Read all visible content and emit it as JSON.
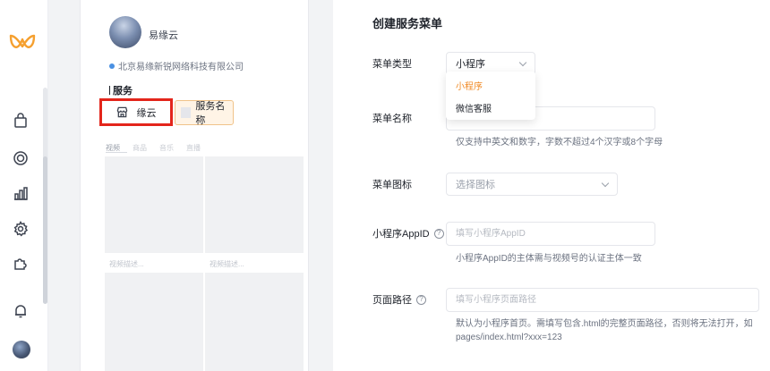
{
  "nav": {
    "items": [
      {
        "icon": "bag-icon"
      },
      {
        "icon": "target-icon"
      },
      {
        "icon": "bar-chart-icon"
      },
      {
        "icon": "gear-icon"
      },
      {
        "icon": "puzzle-icon"
      },
      {
        "icon": "bell-icon"
      }
    ]
  },
  "preview": {
    "account_name": "易缘云",
    "company": "北京易缘新锐网络科技有限公司",
    "services_title": "服务",
    "menu_items": [
      {
        "label": "缘云",
        "icon": "store-icon"
      },
      {
        "label": "服务名称"
      }
    ],
    "tabs": [
      "视频",
      "商品",
      "音乐",
      "直播"
    ],
    "card_captions": [
      "视频描述...",
      "视频描述..."
    ]
  },
  "form": {
    "title": "创建服务菜单",
    "menu_type": {
      "label": "菜单类型",
      "value": "小程序"
    },
    "menu_type_options": [
      {
        "label": "小程序",
        "selected": true
      },
      {
        "label": "微信客服",
        "selected": false
      }
    ],
    "menu_name": {
      "label": "菜单名称",
      "value": "",
      "hint": "仅支持中英文和数字，字数不超过4个汉字或8个字母"
    },
    "menu_icon": {
      "label": "菜单图标",
      "placeholder": "选择图标"
    },
    "appid": {
      "label": "小程序AppID",
      "placeholder": "填写小程序AppID",
      "hint": "小程序AppID的主体需与视频号的认证主体一致"
    },
    "page_path": {
      "label": "页面路径",
      "placeholder": "填写小程序页面路径",
      "hint_line1": "默认为小程序首页。需填写包含.html的完整页面路径，否则将无法打开，如",
      "hint_line2": "pages/index.html?xxx=123"
    }
  },
  "colors": {
    "accent": "#f08a24",
    "highlight": "#e3251b"
  }
}
